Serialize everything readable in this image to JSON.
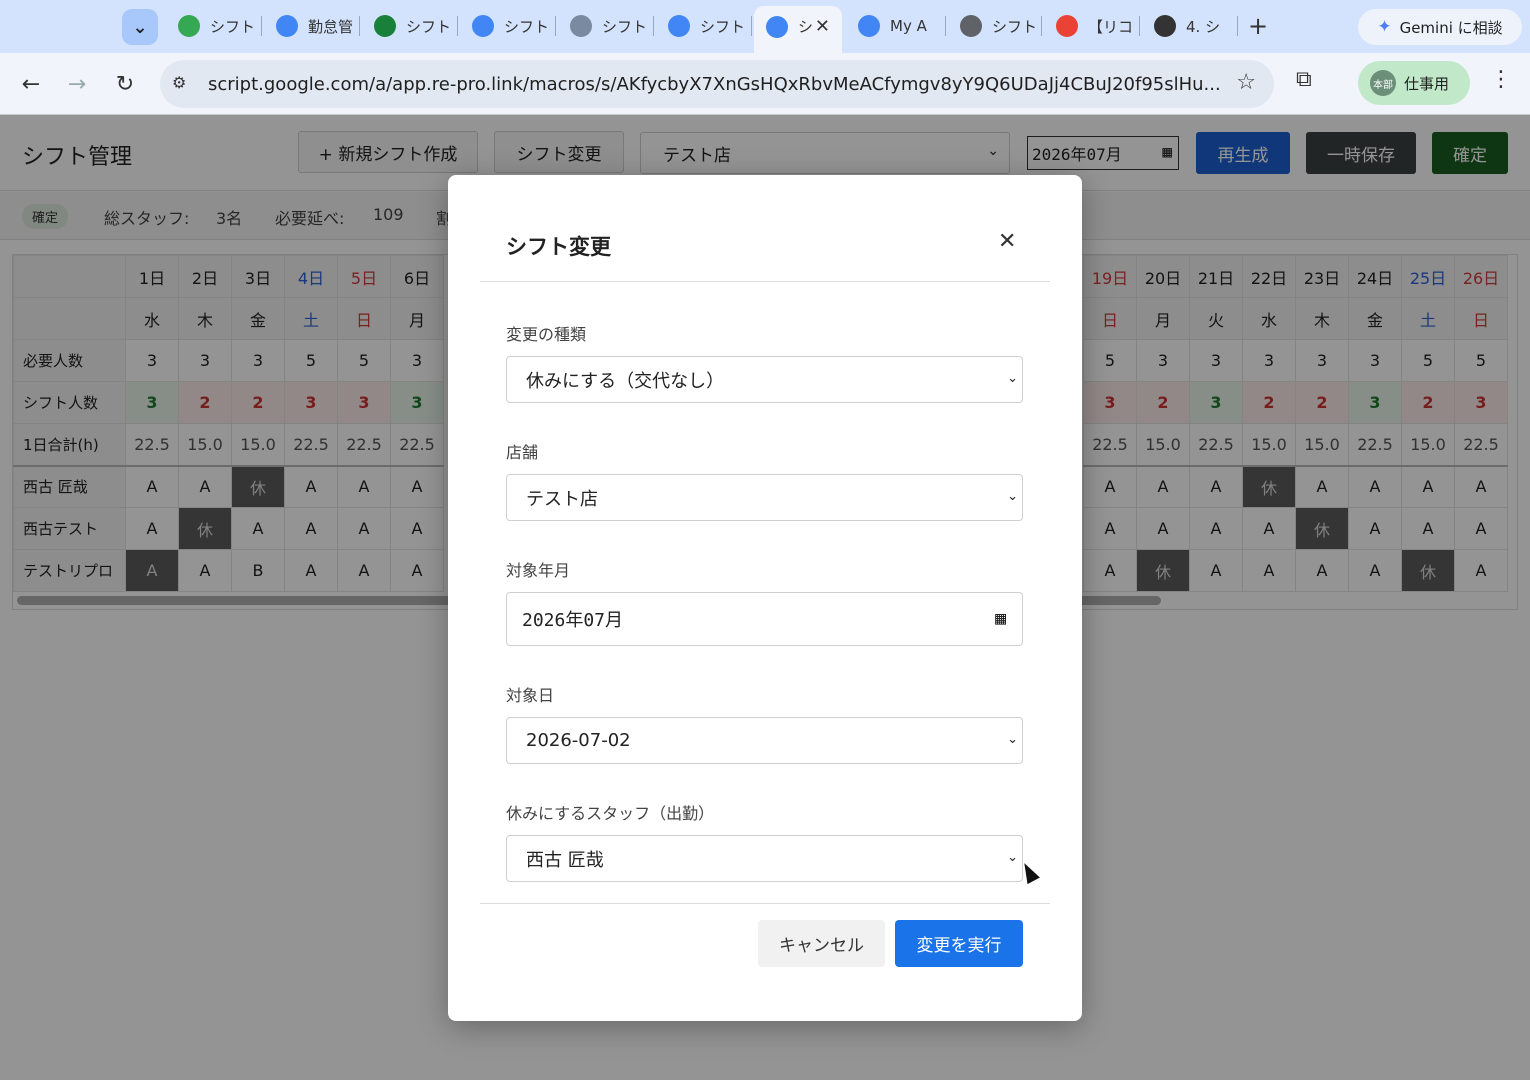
{
  "browser": {
    "tabs": [
      {
        "label": "シフト",
        "icon": "google-drive-icon",
        "color": "#34a853"
      },
      {
        "label": "勤怠管",
        "icon": "apps-script-icon",
        "color": "#4285f4"
      },
      {
        "label": "シフト",
        "icon": "sheets-icon",
        "color": "#188038"
      },
      {
        "label": "シフト",
        "icon": "forms-icon",
        "color": "#4285f4"
      },
      {
        "label": "シフト",
        "icon": "cart-icon",
        "color": "#7a8aa0"
      },
      {
        "label": "シフト",
        "icon": "apps-script-icon",
        "color": "#4285f4"
      },
      {
        "label": "シ",
        "icon": "apps-script-icon",
        "color": "#4285f4",
        "active": true
      },
      {
        "label": "My A",
        "icon": "forms-icon",
        "color": "#4285f4"
      },
      {
        "label": "シフト",
        "icon": "globe-icon",
        "color": "#5f6368"
      },
      {
        "label": "【リコ",
        "icon": "gmail-icon",
        "color": "#ea4335"
      },
      {
        "label": "4. シ",
        "icon": "notion-icon",
        "color": "#333333"
      }
    ],
    "gemini_label": "Gemini に相談",
    "url": "script.google.com/a/app.re-pro.link/macros/s/AKfycbyX7XnGsHQxRbvMeACfymgv8yY9Q6UDaJj4CBuJ20f95slHu...",
    "profile_label": "仕事用",
    "profile_avatar": "本部"
  },
  "header": {
    "title": "シフト管理",
    "new_shift": "+ 新規シフト作成",
    "change_shift": "シフト変更",
    "store": "テスト店",
    "month": "2026年07月",
    "regenerate": "再生成",
    "save_temp": "一時保存",
    "confirm": "確定",
    "colors": {
      "regenerate": "#1a5fd0",
      "save_temp": "#3c4043",
      "confirm": "#1b5e20"
    }
  },
  "summary": {
    "status": "確定",
    "total_staff_label": "総スタッフ:",
    "total_staff_value": "3名",
    "required_label": "必要延べ:",
    "required_value": "109",
    "truncated": "割"
  },
  "grid": {
    "left_days": [
      "1日",
      "2日",
      "3日",
      "4日",
      "5日",
      "6日"
    ],
    "left_weekdays": [
      "水",
      "木",
      "金",
      "土",
      "日",
      "月"
    ],
    "left_types": [
      "",
      "",
      "",
      "sat",
      "sun",
      ""
    ],
    "right_days": [
      "19日",
      "20日",
      "21日",
      "22日",
      "23日",
      "24日",
      "25日",
      "26日"
    ],
    "right_weekdays": [
      "日",
      "月",
      "火",
      "水",
      "木",
      "金",
      "土",
      "日"
    ],
    "right_types": [
      "sun",
      "",
      "",
      "",
      "",
      "",
      "sat",
      "sun"
    ],
    "row_labels": [
      "必要人数",
      "シフト人数",
      "1日合計(h)",
      "西古 匠哉",
      "西古テスト",
      "テストリプロ"
    ],
    "required_left": [
      "3",
      "3",
      "3",
      "5",
      "5",
      "3"
    ],
    "required_right": [
      "5",
      "3",
      "3",
      "3",
      "3",
      "3",
      "5",
      "5"
    ],
    "count_left": [
      "3",
      "2",
      "2",
      "3",
      "3",
      "3"
    ],
    "count_left_state": [
      "ok",
      "ng",
      "ng",
      "ng",
      "ng",
      "ok"
    ],
    "count_right": [
      "3",
      "2",
      "3",
      "2",
      "2",
      "3",
      "2",
      "3"
    ],
    "count_right_state": [
      "ng",
      "ng",
      "ok",
      "ng",
      "ng",
      "ok",
      "ng",
      "ng"
    ],
    "hours_left": [
      "22.5",
      "15.0",
      "15.0",
      "22.5",
      "22.5",
      "22.5"
    ],
    "hours_right": [
      "22.5",
      "15.0",
      "22.5",
      "15.0",
      "15.0",
      "22.5",
      "15.0",
      "22.5"
    ],
    "staff_left": [
      [
        "A",
        "A",
        "休",
        "A",
        "A",
        "A"
      ],
      [
        "A",
        "休",
        "A",
        "A",
        "A",
        "A"
      ],
      [
        "A",
        "A",
        "B",
        "A",
        "A",
        "A"
      ]
    ],
    "staff_right": [
      [
        "A",
        "A",
        "A",
        "休",
        "A",
        "A",
        "A",
        "A"
      ],
      [
        "A",
        "A",
        "A",
        "A",
        "休",
        "A",
        "A",
        "A"
      ],
      [
        "A",
        "休",
        "A",
        "A",
        "A",
        "A",
        "休",
        "A"
      ]
    ],
    "off_left_extra": [
      [
        0,
        0
      ],
      [
        0,
        0
      ],
      [
        1,
        0
      ]
    ]
  },
  "modal": {
    "title": "シフト変更",
    "change_type_label": "変更の種類",
    "change_type_value": "休みにする（交代なし）",
    "store_label": "店舗",
    "store_value": "テスト店",
    "month_label": "対象年月",
    "month_value": "2026年07月",
    "day_label": "対象日",
    "day_value": "2026-07-02",
    "staff_label": "休みにするスタッフ（出勤）",
    "staff_value": "西古 匠哉",
    "cancel": "キャンセル",
    "execute": "変更を実行"
  }
}
